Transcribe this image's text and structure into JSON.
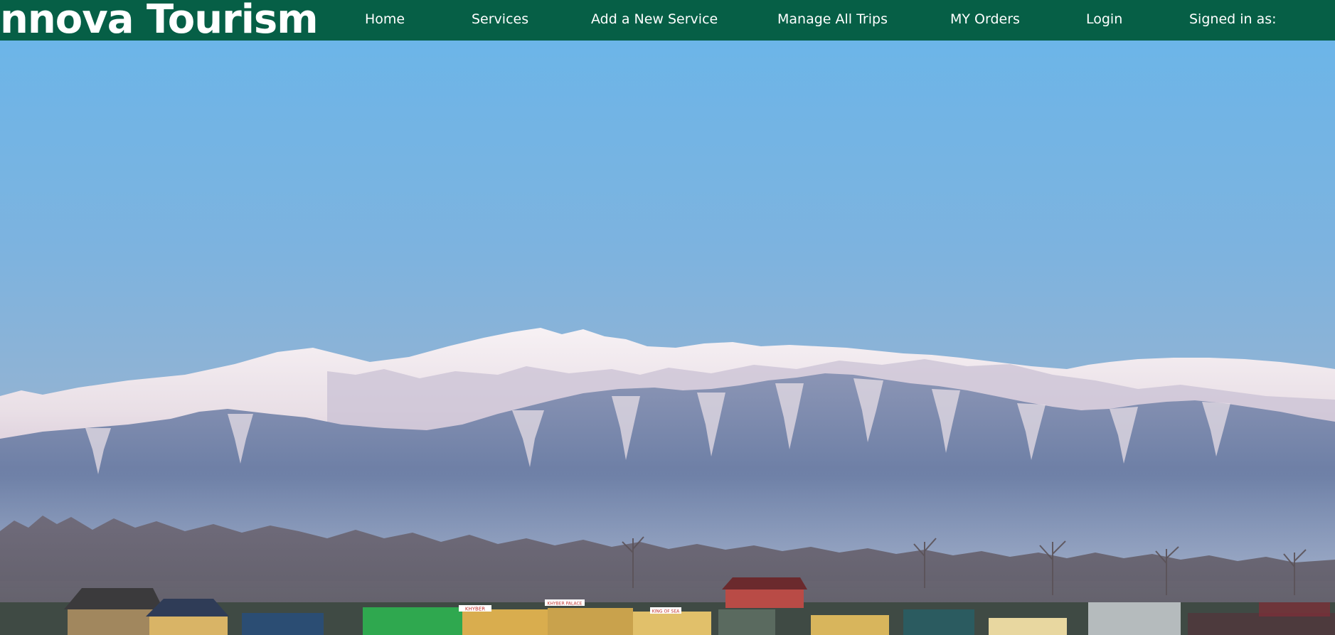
{
  "navbar": {
    "brand": "nnova Tourism",
    "links": [
      {
        "label": "Home"
      },
      {
        "label": "Services"
      },
      {
        "label": "Add a New Service"
      },
      {
        "label": "Manage All Trips"
      },
      {
        "label": "MY Orders"
      },
      {
        "label": "Login"
      }
    ],
    "signed_in_label": "Signed in as:"
  },
  "hero": {
    "image": "kashmir-mountains-dal-lake-photo",
    "signs": [
      "KHYBER",
      "KHYBER PALACE",
      "KING OF SEA"
    ]
  },
  "colors": {
    "navbar_bg": "#065f46",
    "nav_text": "#ffffff"
  }
}
